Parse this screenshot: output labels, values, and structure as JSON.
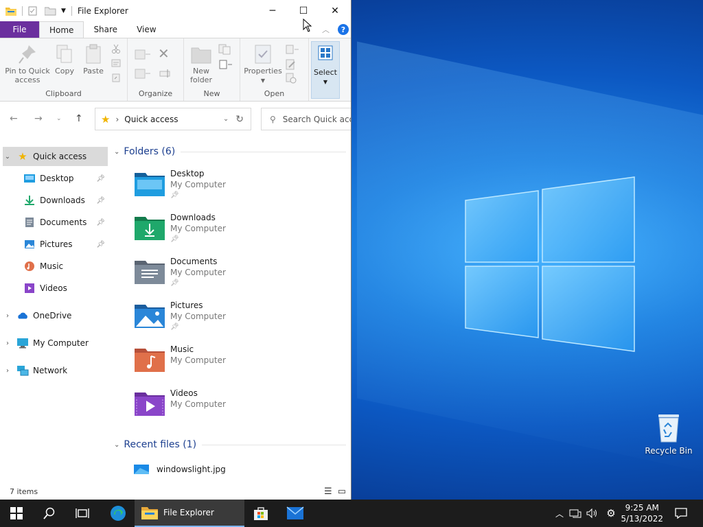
{
  "window": {
    "title": "File Explorer",
    "controls": {
      "minimize": "─",
      "maximize": "☐",
      "close": "✕"
    }
  },
  "ribbon": {
    "tabs": [
      {
        "label": "File"
      },
      {
        "label": "Home"
      },
      {
        "label": "Share"
      },
      {
        "label": "View"
      }
    ],
    "help": "?",
    "groups": {
      "clipboard": "Clipboard",
      "organize": "Organize",
      "new": "New",
      "open": "Open"
    },
    "buttons": {
      "pin_line1": "Pin to Quick",
      "pin_line2": "access",
      "copy": "Copy",
      "paste": "Paste",
      "new_folder_line1": "New",
      "new_folder_line2": "folder",
      "properties": "Properties",
      "select": "Select"
    }
  },
  "address": {
    "location": "Quick access",
    "separator": "›",
    "search_placeholder": "Search Quick acc"
  },
  "nav": {
    "items": [
      {
        "label": "Quick access",
        "icon": "star-icon",
        "selected": true
      },
      {
        "label": "Desktop",
        "icon": "desktop-folder-icon",
        "pinned": true
      },
      {
        "label": "Downloads",
        "icon": "download-icon",
        "pinned": true
      },
      {
        "label": "Documents",
        "icon": "documents-icon",
        "pinned": true
      },
      {
        "label": "Pictures",
        "icon": "pictures-icon",
        "pinned": true
      },
      {
        "label": "Music",
        "icon": "music-icon"
      },
      {
        "label": "Videos",
        "icon": "videos-icon"
      },
      {
        "label": "OneDrive",
        "icon": "cloud-icon"
      },
      {
        "label": "My Computer",
        "icon": "computer-icon"
      },
      {
        "label": "Network",
        "icon": "network-icon"
      }
    ]
  },
  "content": {
    "folders_header": "Folders (6)",
    "recent_header": "Recent files (1)",
    "folders": [
      {
        "name": "Desktop",
        "location": "My Computer",
        "pinned": true,
        "color": "#1f9de0"
      },
      {
        "name": "Downloads",
        "location": "My Computer",
        "pinned": true,
        "color": "#1fa86b"
      },
      {
        "name": "Documents",
        "location": "My Computer",
        "pinned": true,
        "color": "#7d8a99"
      },
      {
        "name": "Pictures",
        "location": "My Computer",
        "pinned": true,
        "color": "#2a86d8"
      },
      {
        "name": "Music",
        "location": "My Computer",
        "pinned": false,
        "color": "#e0704a"
      },
      {
        "name": "Videos",
        "location": "My Computer",
        "pinned": false,
        "color": "#8a45c9"
      }
    ],
    "recent_files": [
      {
        "name": "windowslight.jpg"
      }
    ]
  },
  "status": {
    "item_count": "7 items"
  },
  "desktop": {
    "icons": [
      {
        "label": "Recycle Bin"
      }
    ]
  },
  "taskbar": {
    "active_app": "File Explorer",
    "time": "9:25 AM",
    "date": "5/13/2022"
  }
}
